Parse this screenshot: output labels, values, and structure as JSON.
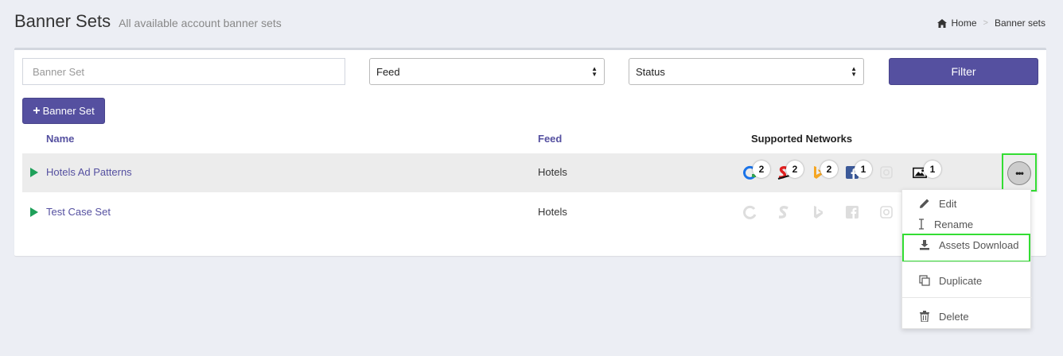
{
  "header": {
    "title": "Banner Sets",
    "subtitle": "All available account banner sets"
  },
  "breadcrumb": {
    "home": "Home",
    "current": "Banner sets"
  },
  "filters": {
    "banner_set_placeholder": "Banner Set",
    "feed_select": "Feed",
    "status_select": "Status",
    "filter_button": "Filter"
  },
  "toolbar": {
    "add_button": "Banner Set"
  },
  "table": {
    "headers": {
      "name": "Name",
      "feed": "Feed",
      "networks": "Supported Networks"
    },
    "rows": [
      {
        "name": "Hotels Ad Patterns",
        "feed": "Hotels",
        "networks": [
          {
            "icon": "google-ads-icon",
            "count": "2",
            "active": true,
            "color": "#1a73e8"
          },
          {
            "icon": "sizmek-icon",
            "count": "2",
            "active": true,
            "color": "#e02020"
          },
          {
            "icon": "bing-icon",
            "count": "2",
            "active": true,
            "color": "#f5a623"
          },
          {
            "icon": "facebook-icon",
            "count": "1",
            "active": true,
            "color": "#3b5998"
          },
          {
            "icon": "instagram-icon",
            "count": "",
            "active": false,
            "color": "#dddddd"
          },
          {
            "icon": "image-icon",
            "count": "1",
            "active": true,
            "color": "#111111"
          }
        ]
      },
      {
        "name": "Test Case Set",
        "feed": "Hotels",
        "networks": [
          {
            "icon": "google-ads-icon",
            "active": false
          },
          {
            "icon": "sizmek-icon",
            "active": false
          },
          {
            "icon": "bing-icon",
            "active": false
          },
          {
            "icon": "facebook-icon",
            "active": false
          },
          {
            "icon": "instagram-icon",
            "active": false
          }
        ]
      }
    ]
  },
  "row_menu": {
    "items": {
      "edit": "Edit",
      "rename": "Rename",
      "assets_download": "Assets Download",
      "duplicate": "Duplicate",
      "delete": "Delete"
    }
  },
  "colors": {
    "accent": "#5550a0",
    "play": "#1fa05a",
    "highlight": "#33dd33"
  }
}
